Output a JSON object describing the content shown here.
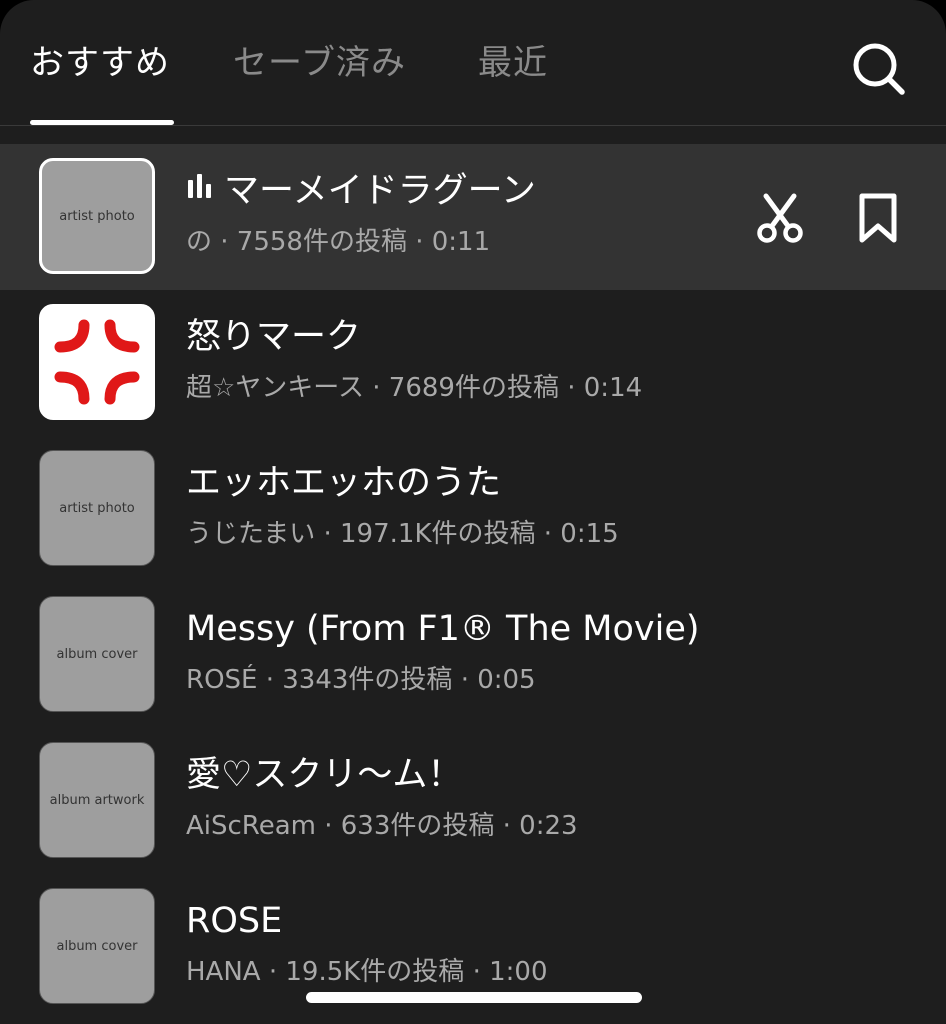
{
  "tabs": {
    "recommended": "おすすめ",
    "saved": "セーブ済み",
    "recent": "最近"
  },
  "tracks": [
    {
      "title": "マーメイドラグーン",
      "artist": "の",
      "posts": "7558件の投稿",
      "duration": "0:11",
      "meta": "の · 7558件の投稿 · 0:11",
      "thumbnail": "artist photo"
    },
    {
      "title": "怒りマーク",
      "artist": "超☆ヤンキース",
      "posts": "7689件の投稿",
      "duration": "0:14",
      "meta": "超☆ヤンキース · 7689件の投稿 · 0:14",
      "thumbnail": "anger mark"
    },
    {
      "title": "エッホエッホのうた",
      "artist": "うじたまい",
      "posts": "197.1K件の投稿",
      "duration": "0:15",
      "meta": "うじたまい · 197.1K件の投稿 · 0:15",
      "thumbnail": "artist photo"
    },
    {
      "title": "Messy (From F1® The Movie)",
      "artist": "ROSÉ",
      "posts": "3343件の投稿",
      "duration": "0:05",
      "meta": "ROSÉ · 3343件の投稿 · 0:05",
      "thumbnail": "album cover"
    },
    {
      "title": "愛♡スクリ〜ム！",
      "artist": "AiScReam",
      "posts": "633件の投稿",
      "duration": "0:23",
      "meta": "AiScReam · 633件の投稿 · 0:23",
      "thumbnail": "album artwork"
    },
    {
      "title": "ROSE",
      "artist": "HANA",
      "posts": "19.5K件の投稿",
      "duration": "1:00",
      "meta": "HANA · 19.5K件の投稿 · 1:00",
      "thumbnail": "album cover"
    }
  ],
  "icons": {
    "search": "search-icon",
    "now_playing": "audio-bars-icon",
    "use_sound": "scissors-icon",
    "save": "bookmark-icon"
  },
  "colors": {
    "panel_bg": "#1e1e1e",
    "selected_row_bg": "#333333",
    "text_primary": "#ffffff",
    "text_secondary": "#a9a9a9",
    "tab_inactive": "#8a8a8a",
    "anger_mark_red": "#e01818"
  }
}
